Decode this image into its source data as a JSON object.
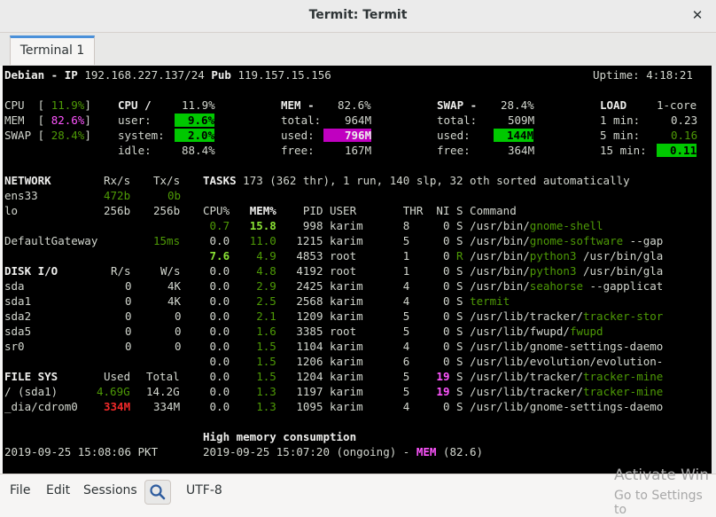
{
  "window": {
    "title": "Termit: Termit"
  },
  "tabs": [
    {
      "label": "Terminal 1"
    }
  ],
  "terminal": {
    "header_host": "Debian - IP",
    "header_ip": "192.168.227.137/24",
    "header_pub": "Pub",
    "header_pub_ip": "119.157.15.156",
    "uptime": "Uptime: 4:18:21",
    "cpu_summary": "CPU  [ 11.9%]",
    "mem_summary": "MEM  [ 82.6%]",
    "swap_summary": "SWAP [ 28.4%]",
    "cpu_pct": "11.9%",
    "mem_pct": "82.6%",
    "swap_pct": "28.4%",
    "cpu_title": "CPU /",
    "cpu_user": "9.6%",
    "cpu_system": "2.0%",
    "cpu_idle": "88.4%",
    "mem_title": "MEM -",
    "mem_total": "964M",
    "mem_used": "796M",
    "mem_free": "167M",
    "swap_title": "SWAP -",
    "swap_total": "509M",
    "swap_used": "144M",
    "swap_free": "364M",
    "load_title": "LOAD",
    "load_cores": "1-core",
    "load_1": "0.23",
    "load_5": "0.16",
    "load_15": "0.11",
    "network": {
      "header": "NETWORK",
      "rx": "Rx/s",
      "tx": "Tx/s",
      "rows": [
        [
          "ens33",
          "472b",
          "0b"
        ],
        [
          "lo",
          "256b",
          "256b"
        ]
      ],
      "gateway": "DefaultGateway",
      "gateway_ms": "15ms"
    },
    "disk": {
      "header": "DISK I/O",
      "r": "R/s",
      "w": "W/s",
      "rows": [
        [
          "sda",
          "0",
          "4K"
        ],
        [
          "sda1",
          "0",
          "4K"
        ],
        [
          "sda2",
          "0",
          "0"
        ],
        [
          "sda5",
          "0",
          "0"
        ],
        [
          "sr0",
          "0",
          "0"
        ]
      ]
    },
    "fs": {
      "header": "FILE SYS",
      "used": "Used",
      "total": "Total",
      "rows": [
        [
          "/ (sda1)",
          "4.69G",
          "14.2G"
        ],
        [
          "_dia/cdrom0",
          "334M",
          "334M"
        ]
      ]
    },
    "tasks": "TASKS 173 (362 thr), 1 run, 140 slp, 32 oth sorted automatically",
    "proc_header": "CPU%   MEM%    PID USER       THR  NI S Command",
    "processes": [
      [
        "0.7",
        "15.8",
        "998",
        "karim",
        "8",
        "0",
        "S",
        "/usr/bin/",
        "gnome-shell",
        ""
      ],
      [
        "0.0",
        "11.0",
        "1215",
        "karim",
        "5",
        "0",
        "S",
        "/usr/bin/",
        "gnome-software",
        " --gap"
      ],
      [
        "7.6",
        "4.9",
        "4853",
        "root",
        "1",
        "0",
        "R",
        "/usr/bin/",
        "python3",
        " /usr/bin/gla"
      ],
      [
        "0.0",
        "4.8",
        "4192",
        "root",
        "1",
        "0",
        "S",
        "/usr/bin/",
        "python3",
        " /usr/bin/gla"
      ],
      [
        "0.0",
        "2.9",
        "2425",
        "karim",
        "4",
        "0",
        "S",
        "/usr/bin/",
        "seahorse",
        " --gapplicat"
      ],
      [
        "0.0",
        "2.5",
        "2568",
        "karim",
        "4",
        "0",
        "S",
        "",
        "termit",
        ""
      ],
      [
        "0.0",
        "2.1",
        "1209",
        "karim",
        "5",
        "0",
        "S",
        "/usr/lib/tracker/",
        "tracker-stor",
        ""
      ],
      [
        "0.0",
        "1.6",
        "3385",
        "root",
        "5",
        "0",
        "S",
        "/usr/lib/fwupd/",
        "fwupd",
        ""
      ],
      [
        "0.0",
        "1.5",
        "1104",
        "karim",
        "4",
        "0",
        "S",
        "/usr/lib/gnome-settings-daemo",
        "",
        ""
      ],
      [
        "0.0",
        "1.5",
        "1206",
        "karim",
        "6",
        "0",
        "S",
        "/usr/lib/evolution/evolution-",
        "",
        ""
      ],
      [
        "0.0",
        "1.5",
        "1204",
        "karim",
        "5",
        "19",
        "S",
        "/usr/lib/tracker/",
        "tracker-mine",
        ""
      ],
      [
        "0.0",
        "1.3",
        "1197",
        "karim",
        "5",
        "19",
        "S",
        "/usr/lib/tracker/",
        "tracker-mine",
        ""
      ],
      [
        "0.0",
        "1.3",
        "1095",
        "karim",
        "4",
        "0",
        "S",
        "/usr/lib/gnome-settings-daemo",
        "",
        ""
      ]
    ],
    "alert_title": "High memory consumption",
    "clock": "2019-09-25 15:08:06 PKT",
    "alert_time": "2019-09-25 15:07:20 (ongoing) - ",
    "alert_mem": "MEM",
    "alert_val": " (82.6)"
  },
  "menubar": {
    "file": "File",
    "edit": "Edit",
    "sessions": "Sessions",
    "encoding": "UTF-8"
  },
  "watermark": {
    "line1": "Activate Win",
    "line2": "Go to Settings to"
  }
}
